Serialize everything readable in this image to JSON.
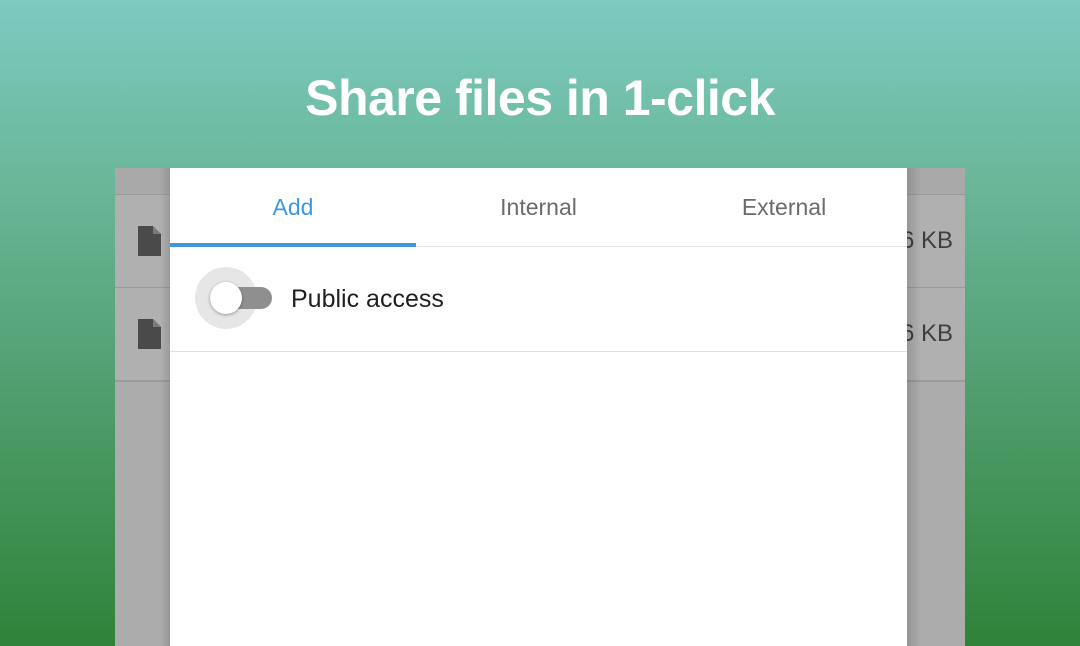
{
  "headline": "Share files in 1-click",
  "background_list": {
    "rows": [
      {
        "icon": "file-icon",
        "size": "6 KB"
      },
      {
        "icon": "file-icon",
        "size": "6 KB"
      }
    ]
  },
  "dialog": {
    "tabs": [
      {
        "label": "Add",
        "active": true
      },
      {
        "label": "Internal",
        "active": false
      },
      {
        "label": "External",
        "active": false
      }
    ],
    "public_access": {
      "label": "Public access",
      "enabled": false
    }
  },
  "colors": {
    "accent": "#3d98df",
    "gradient_top": "#7ccbc0",
    "gradient_bottom": "#2e8338"
  }
}
